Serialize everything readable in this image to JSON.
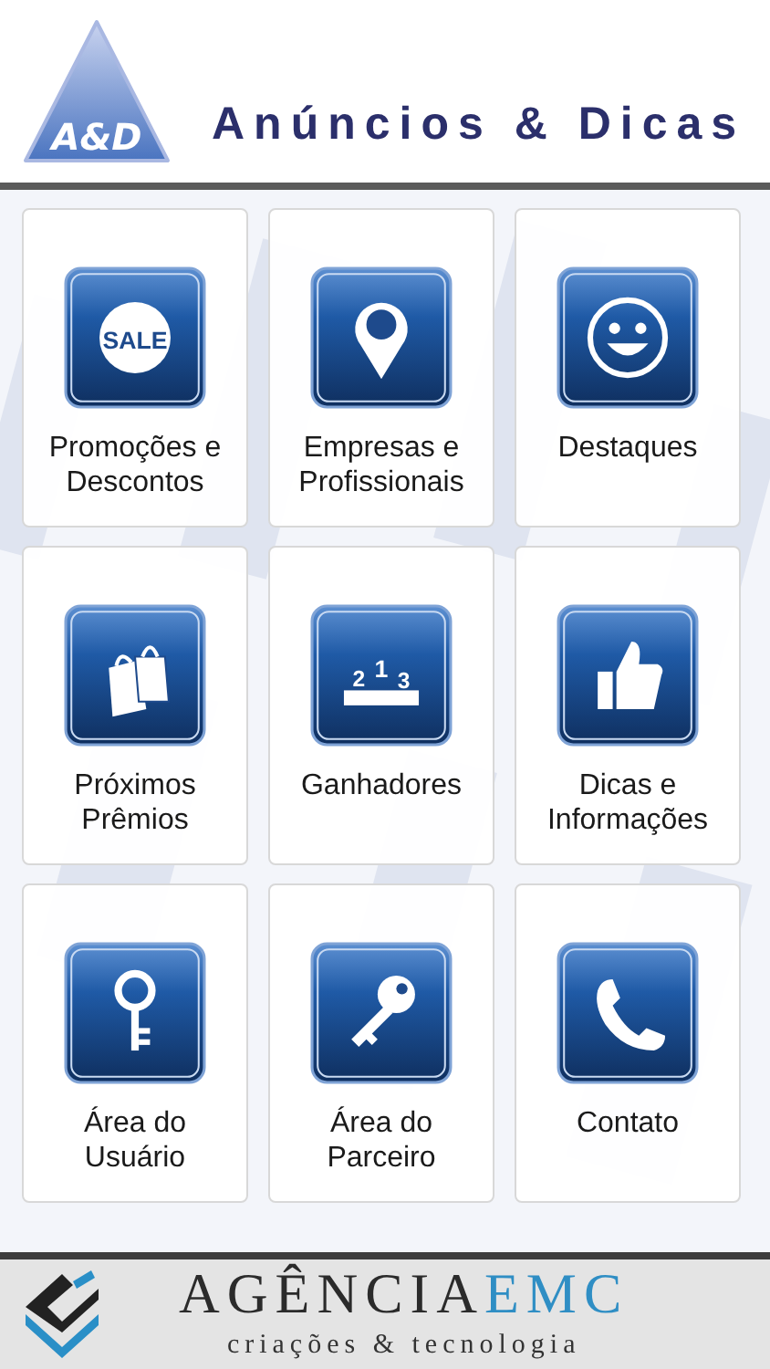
{
  "header": {
    "logo_text": "A&D",
    "title": "Anúncios & Dicas"
  },
  "tiles": [
    {
      "label": "Promoções e Descontos",
      "icon_text": [
        "SALE"
      ]
    },
    {
      "label": "Empresas e Profissionais"
    },
    {
      "label": "Destaques"
    },
    {
      "label": "Próximos Prêmios"
    },
    {
      "label": "Ganhadores",
      "icon_text": [
        "2",
        "1",
        "3"
      ]
    },
    {
      "label": "Dicas e Informações"
    },
    {
      "label": "Área do Usuário"
    },
    {
      "label": "Área do Parceiro"
    },
    {
      "label": "Contato"
    }
  ],
  "footer": {
    "brand": "AGÊNCIA",
    "brand_accent": "EMC",
    "tagline": "criações & tecnologia"
  }
}
